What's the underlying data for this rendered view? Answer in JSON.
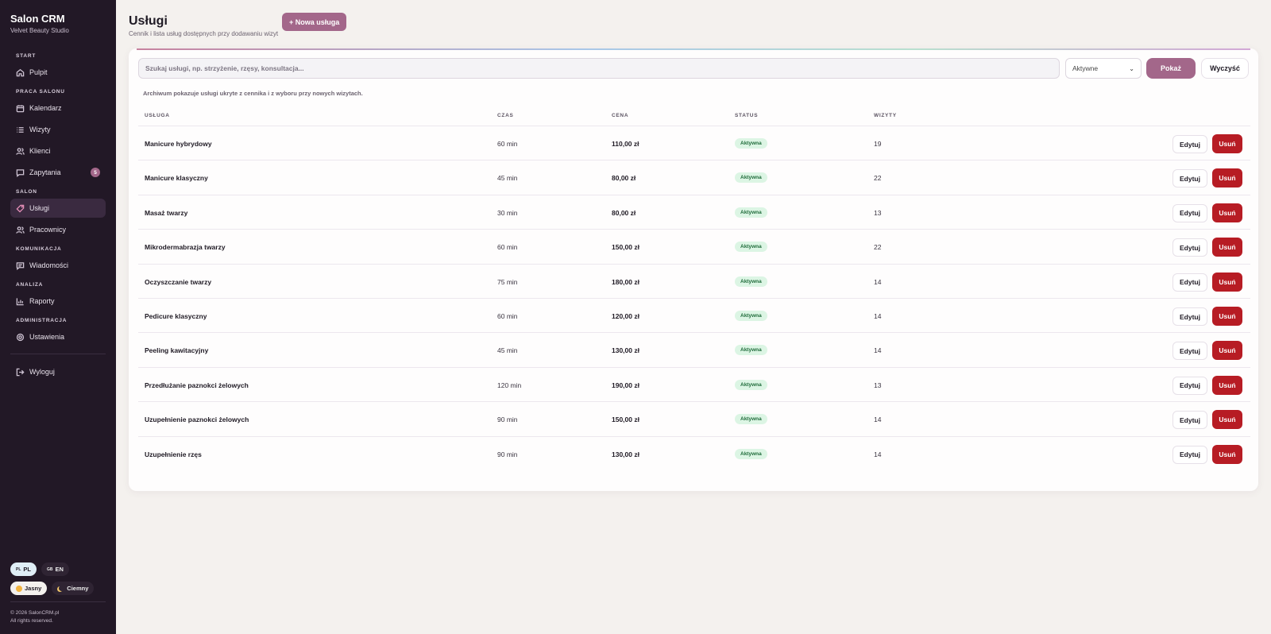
{
  "sidebar": {
    "brand": "Salon CRM",
    "brand_sub": "Velvet Beauty Studio",
    "sections": {
      "start": "START",
      "praca": "PRACA SALONU",
      "salon": "SALON",
      "komunikacja": "KOMUNIKACJA",
      "analiza": "ANALIZA",
      "administracja": "ADMINISTRACJA"
    },
    "items": {
      "pulpit": "Pulpit",
      "kalendarz": "Kalendarz",
      "wizyty": "Wizyty",
      "klienci": "Klienci",
      "zapytania": "Zapytania",
      "zapytania_badge": "5",
      "uslugi": "Usługi",
      "pracownicy": "Pracownicy",
      "wiadomosci": "Wiadomości",
      "raporty": "Raporty",
      "ustawienia": "Ustawienia",
      "wyloguj": "Wyloguj"
    },
    "lang": {
      "pl_flag": "PL",
      "pl": "PL",
      "en_flag": "GB",
      "en": "EN"
    },
    "theme": {
      "light_icon": "sun-icon",
      "light": "Jasny",
      "dark_icon": "moon-icon",
      "dark": "Ciemny"
    },
    "footer_line1": "© 2026 SalonCRM.pl",
    "footer_line2": "All rights reserved."
  },
  "header": {
    "title": "Usługi",
    "subtitle": "Cennik i lista usług dostępnych przy dodawaniu wizyt",
    "new_button": "+ Nowa usługa"
  },
  "filters": {
    "search_placeholder": "Szukaj usługi, np. strzyżenie, rzęsy, konsultacja...",
    "status_selected": "Aktywne",
    "show_button": "Pokaż",
    "clear_button": "Wyczyść",
    "archive_note": "Archiwum pokazuje usługi ukryte z cennika i z wyboru przy nowych wizytach."
  },
  "table": {
    "headers": {
      "service": "USŁUGA",
      "time": "CZAS",
      "price": "CENA",
      "status": "STATUS",
      "visits": "WIZYTY"
    },
    "edit_label": "Edytuj",
    "delete_label": "Usuń",
    "rows": [
      {
        "name": "Manicure hybrydowy",
        "time": "60 min",
        "price": "110,00 zł",
        "status": "Aktywna",
        "visits": "19"
      },
      {
        "name": "Manicure klasyczny",
        "time": "45 min",
        "price": "80,00 zł",
        "status": "Aktywna",
        "visits": "22"
      },
      {
        "name": "Masaż twarzy",
        "time": "30 min",
        "price": "80,00 zł",
        "status": "Aktywna",
        "visits": "13"
      },
      {
        "name": "Mikrodermabrazja twarzy",
        "time": "60 min",
        "price": "150,00 zł",
        "status": "Aktywna",
        "visits": "22"
      },
      {
        "name": "Oczyszczanie twarzy",
        "time": "75 min",
        "price": "180,00 zł",
        "status": "Aktywna",
        "visits": "14"
      },
      {
        "name": "Pedicure klasyczny",
        "time": "60 min",
        "price": "120,00 zł",
        "status": "Aktywna",
        "visits": "14"
      },
      {
        "name": "Peeling kawitacyjny",
        "time": "45 min",
        "price": "130,00 zł",
        "status": "Aktywna",
        "visits": "14"
      },
      {
        "name": "Przedłużanie paznokci żelowych",
        "time": "120 min",
        "price": "190,00 zł",
        "status": "Aktywna",
        "visits": "13"
      },
      {
        "name": "Uzupełnienie paznokci żelowych",
        "time": "90 min",
        "price": "150,00 zł",
        "status": "Aktywna",
        "visits": "14"
      },
      {
        "name": "Uzupełnienie rzęs",
        "time": "90 min",
        "price": "130,00 zł",
        "status": "Aktywna",
        "visits": "14"
      }
    ]
  },
  "colors": {
    "sidebar_bg": "#221826",
    "accent": "#a3678a",
    "danger": "#b71c24",
    "active_badge_bg": "#dcf5e4",
    "active_badge_text": "#1f6b3a"
  }
}
